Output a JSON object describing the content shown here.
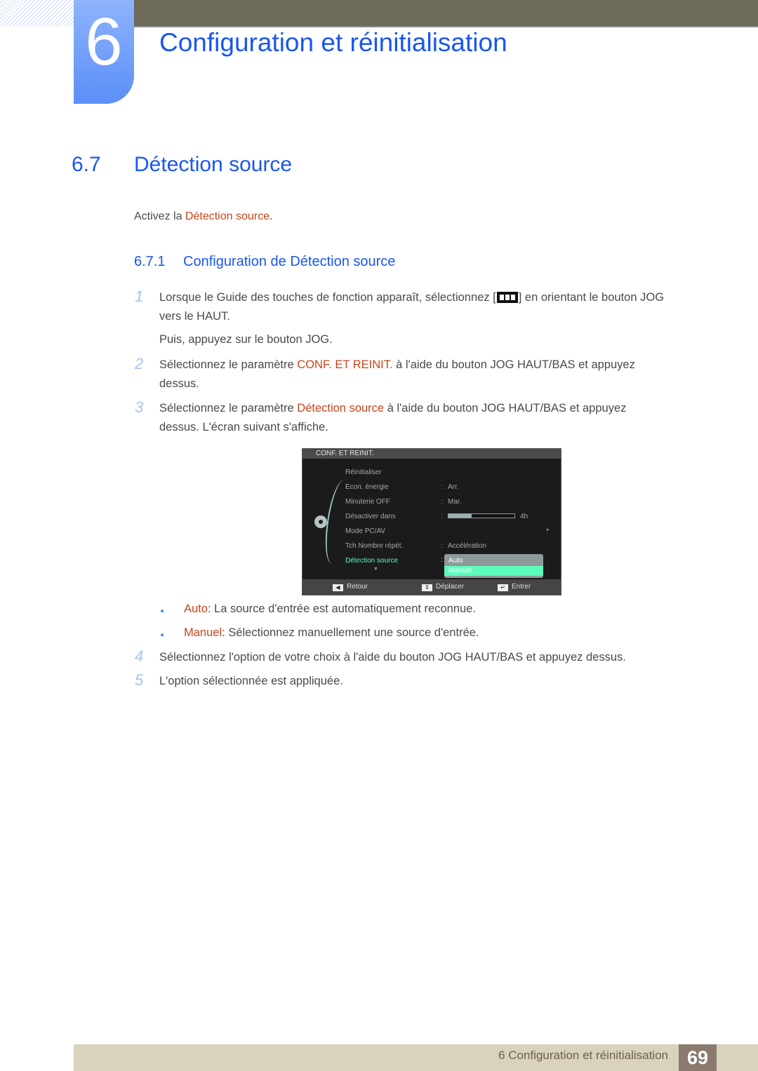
{
  "chapter": {
    "number": "6",
    "title": "Configuration et réinitialisation"
  },
  "section": {
    "number": "6.7",
    "title": "Détection source"
  },
  "intro": {
    "prefix": "Activez la ",
    "highlight": "Détection source",
    "suffix": "."
  },
  "subsection": {
    "number": "6.7.1",
    "title": "Configuration de Détection source"
  },
  "steps": [
    {
      "n": "1",
      "line1_a": "Lorsque le Guide des touches de fonction apparaît, sélectionnez [",
      "icon": "menu-grid-icon",
      "line1_b": "] en orientant le bouton JOG",
      "line2": "vers le HAUT.",
      "line3": "Puis, appuyez sur le bouton JOG."
    },
    {
      "n": "2",
      "a": "Sélectionnez le paramètre ",
      "hl": "CONF. ET REINIT.",
      "b": " à l'aide du bouton JOG HAUT/BAS et appuyez",
      "line2": "dessus."
    },
    {
      "n": "3",
      "a": "Sélectionnez le paramètre ",
      "hl": "Détection source",
      "b": " à l'aide du bouton JOG HAUT/BAS et appuyez",
      "line2": "dessus. L'écran suivant s'affiche."
    },
    {
      "n": "4",
      "text": "Sélectionnez l'option de votre choix à l'aide du bouton JOG HAUT/BAS et appuyez dessus."
    },
    {
      "n": "5",
      "text": "L'option sélectionnée est appliquée."
    }
  ],
  "bullets": [
    {
      "hl": "Auto",
      "text": ": La source d'entrée est automatiquement reconnue."
    },
    {
      "hl": "Manuel",
      "text": ": Sélectionnez manuellement une source d'entrée."
    }
  ],
  "osd": {
    "header": "CONF. ET REINIT.",
    "rows": [
      {
        "label": "Réinitialiser",
        "value": ""
      },
      {
        "label": "Econ. énergie",
        "value": "Arr."
      },
      {
        "label": "Minuterie OFF",
        "value": "Mar."
      },
      {
        "label": "Désactiver dans",
        "value": "4h",
        "progress": 0.35
      },
      {
        "label": "Mode PC/AV",
        "value": "▸"
      },
      {
        "label": "Tch Nombre répét.",
        "value": "Accélération"
      },
      {
        "label": "Détection source",
        "value": ""
      }
    ],
    "more_arrow": "▼",
    "dropdown": {
      "options": [
        "Auto",
        "Manuel"
      ],
      "selected": "Manuel"
    },
    "footer": {
      "back": "Retour",
      "move": "Déplacer",
      "enter": "Entrer"
    },
    "active_color": "#5dfcbc"
  },
  "footer": {
    "text": "6 Configuration et réinitialisation",
    "page": "69"
  }
}
